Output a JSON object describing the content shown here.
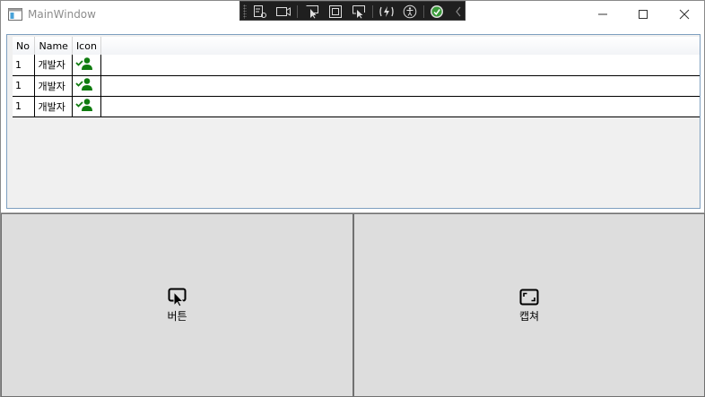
{
  "window": {
    "title": "MainWindow"
  },
  "devtools": {
    "tools": [
      "select-element-icon",
      "track-focus-icon",
      "select-in-app-icon",
      "display-layout-adorners-icon",
      "preview-selection-icon",
      "hot-reload-icon",
      "accessibility-icon",
      "binding-check-icon",
      "collapse-icon"
    ]
  },
  "grid": {
    "headers": [
      "No",
      "Name",
      "Icon"
    ],
    "rows": [
      {
        "no": "1",
        "name": "개발자",
        "icon": "user-icon"
      },
      {
        "no": "1",
        "name": "개발자",
        "icon": "user-icon"
      },
      {
        "no": "1",
        "name": "개발자",
        "icon": "user-icon"
      }
    ]
  },
  "buttons": {
    "left": {
      "label": "버튼",
      "icon": "click-pointer-icon"
    },
    "right": {
      "label": "캡쳐",
      "icon": "capture-icon"
    }
  },
  "colors": {
    "accent_green": "#107c10",
    "grid_border": "#7e9fbf",
    "button_bg": "#dddddd"
  }
}
